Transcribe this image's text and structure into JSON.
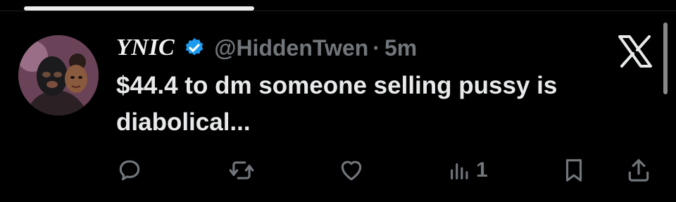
{
  "tweet": {
    "display_name": "YNIC",
    "handle": "@HiddenTwen",
    "separator": "·",
    "time": "5m",
    "text": "$44.4 to dm someone selling pussy is diabolical...",
    "views_count": "1"
  },
  "icons": {
    "verified": "verified-badge-icon",
    "close": "x-logo-icon",
    "reply": "reply-icon",
    "retweet": "retweet-icon",
    "like": "heart-icon",
    "views": "bar-chart-icon",
    "bookmark": "bookmark-icon",
    "share": "share-icon"
  },
  "colors": {
    "background": "#000000",
    "text": "#e7e9ea",
    "muted": "#71767b",
    "verified_blue": "#1d9bf0"
  }
}
